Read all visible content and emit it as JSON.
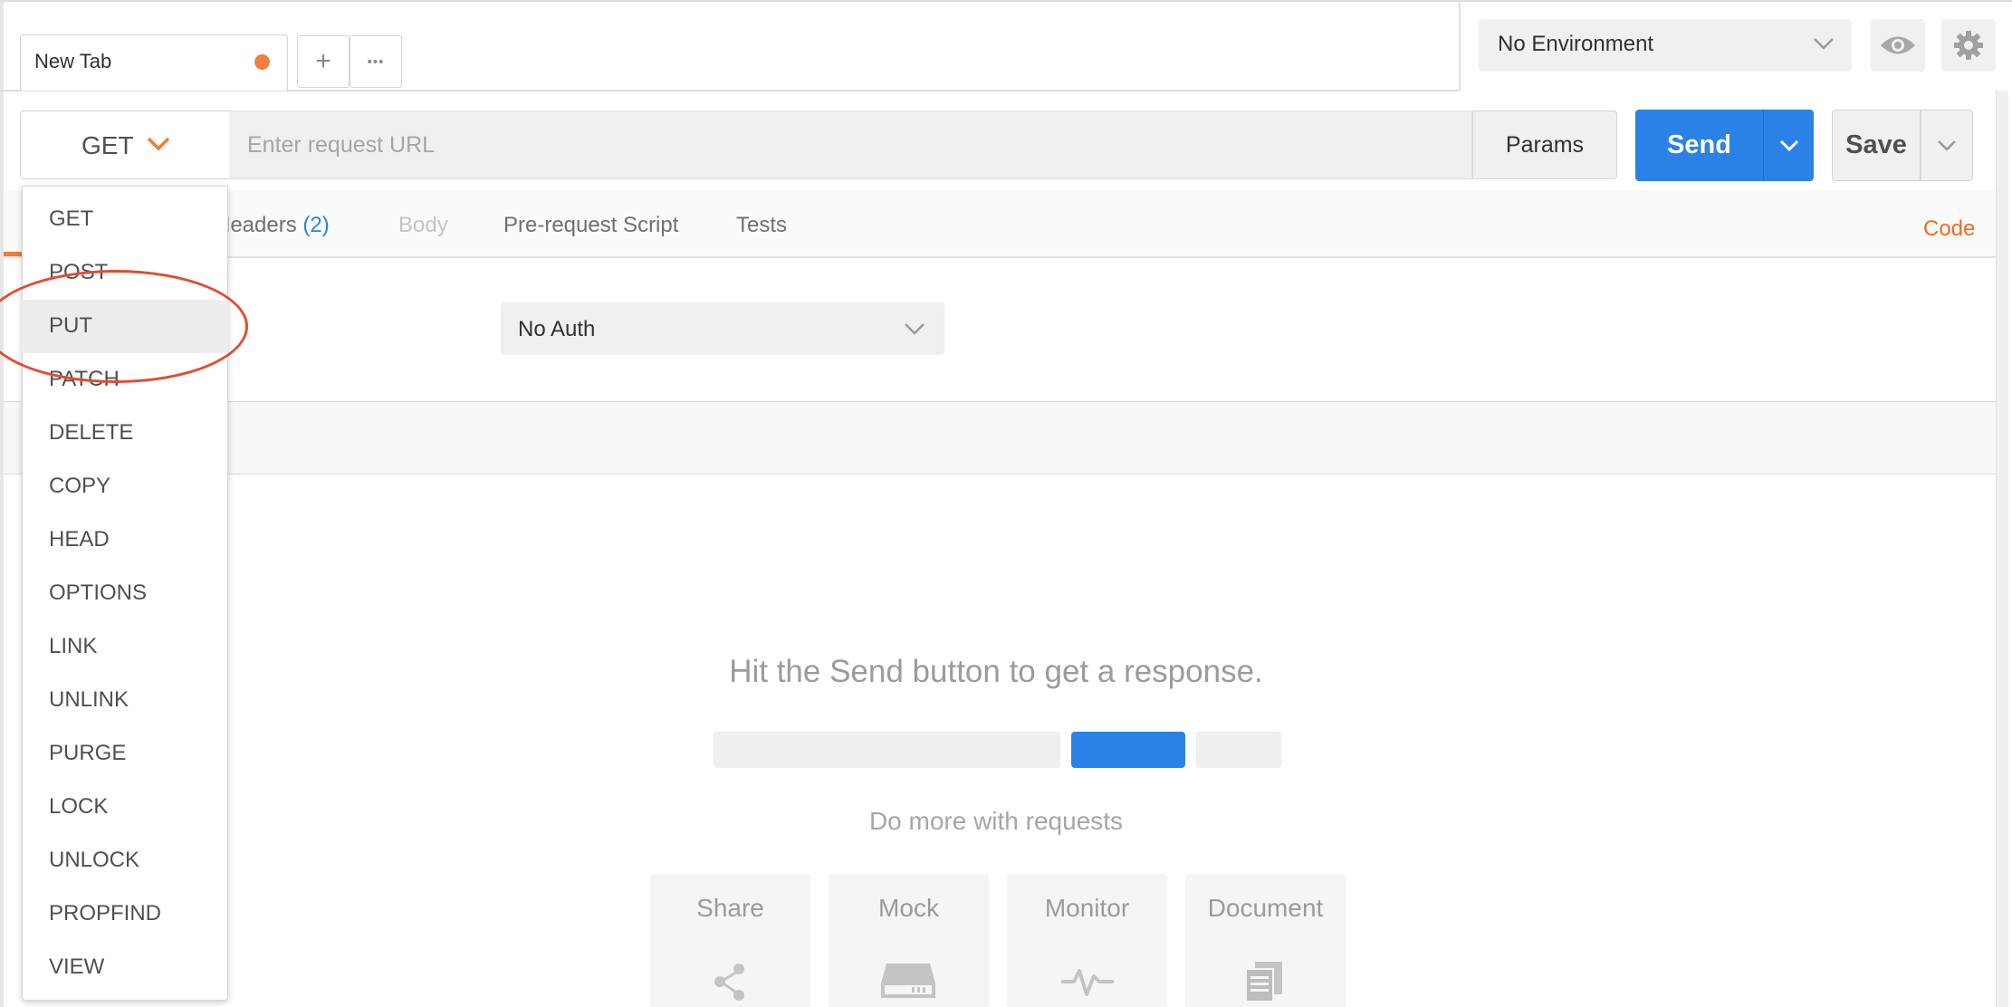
{
  "tabs": {
    "active": {
      "label": "New Tab"
    },
    "new_tab_glyph": "+",
    "more_glyph": "•••"
  },
  "environment": {
    "selected": "No Environment"
  },
  "request": {
    "method": "GET",
    "url_value": "",
    "url_placeholder": "Enter request URL",
    "params_label": "Params",
    "send_label": "Send",
    "save_label": "Save"
  },
  "subtabs": {
    "headers": "Headers",
    "headers_count": "(2)",
    "body": "Body",
    "prerequest": "Pre-request Script",
    "tests": "Tests",
    "code": "Code"
  },
  "auth": {
    "selected": "No Auth"
  },
  "response": {
    "empty_message": "Hit the Send button to get a response.",
    "more_message": "Do more with requests",
    "cards": [
      "Share",
      "Mock",
      "Monitor",
      "Document"
    ]
  },
  "method_menu": {
    "items": [
      "GET",
      "POST",
      "PUT",
      "PATCH",
      "DELETE",
      "COPY",
      "HEAD",
      "OPTIONS",
      "LINK",
      "UNLINK",
      "PURGE",
      "LOCK",
      "UNLOCK",
      "PROPFIND",
      "VIEW"
    ],
    "highlighted": "PUT"
  },
  "colors": {
    "accent_orange": "#f26b1d",
    "send_blue": "#2b82e6",
    "annotation_red": "#e34b32",
    "tab_dot": "#f0803c"
  },
  "icons": [
    "close-dot-icon",
    "plus-icon",
    "more-dots-icon",
    "chevron-down-icon",
    "eye-icon",
    "gear-icon",
    "share-icon",
    "mock-server-icon",
    "monitor-icon",
    "document-icon"
  ]
}
